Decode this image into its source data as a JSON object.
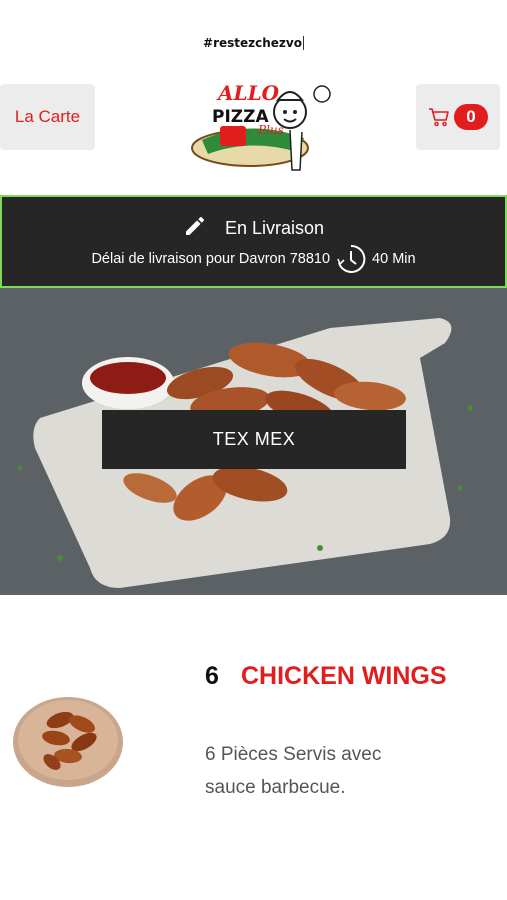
{
  "hashtag": "#restezchezvo",
  "header": {
    "menu_label": "La Carte",
    "cart_count": "0",
    "logo_text": "ALLO PIZZA PLUS"
  },
  "delivery": {
    "mode": "En Livraison",
    "delay_text": "Délai de livraison pour Davron 78810",
    "delay_time": "40 Min"
  },
  "category": {
    "label": "TEX MEX"
  },
  "product": {
    "quantity": "6",
    "name": "CHICKEN WINGS",
    "description": "6 Pièces  Servis avec sauce barbecue."
  },
  "colors": {
    "accent": "#e21d1d",
    "dark_panel": "#262626",
    "panel_border": "#7ed957",
    "button_bg": "#ececec"
  },
  "icons": [
    "cart-icon",
    "pencil-icon",
    "clock-icon"
  ]
}
